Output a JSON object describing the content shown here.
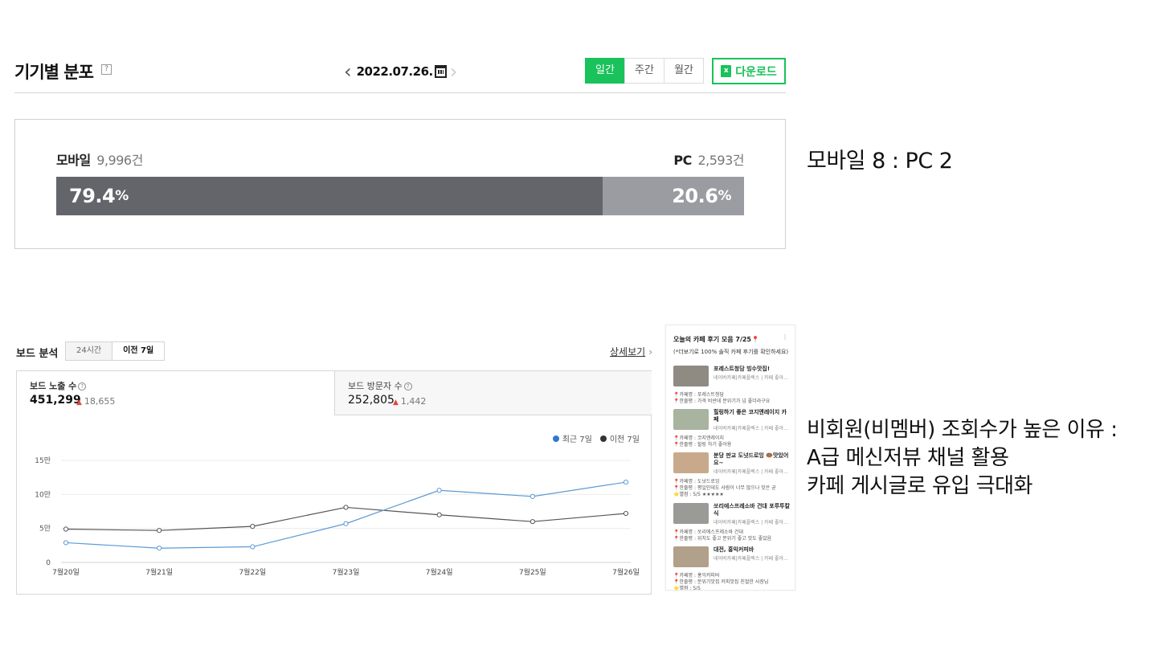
{
  "device": {
    "title": "기기별 분포",
    "help": "?",
    "date": "2022.07.26.",
    "periods": [
      "일간",
      "주간",
      "월간"
    ],
    "active_period": 0,
    "download_label": "다운로드",
    "download_icon_text": "x",
    "mobile_label": "모바일",
    "mobile_count": "9,996건",
    "pc_label": "PC",
    "pc_count": "2,593건",
    "mobile_pct": "79.4",
    "pc_pct": "20.6",
    "pct_unit": "%",
    "mobile_share": 0.794,
    "colors": {
      "accent": "#19c25a",
      "mobile": "#63656b",
      "pc": "#9b9ca1"
    }
  },
  "note1": "모바일 8 : PC 2",
  "board": {
    "title": "보드 분석",
    "tabs": [
      "24시간",
      "이전 7일"
    ],
    "active_tab": 1,
    "detail_link": "상세보기",
    "impressions_label": "보드 노출 수",
    "impressions_value": "451,299",
    "impressions_delta": "18,655",
    "visitors_label": "보드 방문자 수",
    "visitors_value": "252,805",
    "visitors_delta": "1,442",
    "legend_recent": "최근 7일",
    "legend_prev": "이전 7일"
  },
  "chart_data": {
    "type": "line",
    "x": [
      "7월20일",
      "7월21일",
      "7월22일",
      "7월23일",
      "7월24일",
      "7월25일",
      "7월26일"
    ],
    "y_ticks": [
      "0",
      "5만",
      "10만",
      "15만"
    ],
    "ylim": [
      0,
      150000
    ],
    "grid": true,
    "legend": "top-right",
    "series": [
      {
        "name": "최근 7일",
        "color": "#5b9bd5",
        "values": [
          29000,
          21000,
          23000,
          57000,
          106000,
          97000,
          118000
        ]
      },
      {
        "name": "이전 7일",
        "color": "#555555",
        "values": [
          49000,
          47000,
          53000,
          81000,
          70000,
          60000,
          72000
        ]
      }
    ]
  },
  "phone": {
    "title": "오늘의 카페 후기 모음 7/25📍",
    "subtitle": "(*더보기로 100% 솔직 카페 후기를 확인하세요)",
    "items": [
      {
        "name": "포레스트청담 빙수맛집!",
        "src": "네이버카페|카페플렉스 | 카페 좋아…",
        "meta": [
          "📍카페명 : 포레스트청담",
          "📍한줄평 : 가격 비싼데 분위기가 넘 좋더라구요"
        ]
      },
      {
        "name": "힐링하기 좋은 코지앤레이지 카페",
        "src": "네이버카페|카페플렉스 | 카페 좋아…",
        "meta": [
          "📍카페명 : 코지앤레이지",
          "📍한줄평 : 힐링 하기 좋아용"
        ]
      },
      {
        "name": "분당 판교 도넛드로잉 🍩맛있어요~",
        "src": "네이버카페|카페플렉스 | 카페 좋아…",
        "meta": [
          "📍카페명 : 도넛드로잉",
          "📍한줄평 : 평일인데도 사람이 너무 많으나 맛은 굳",
          "⭐별점 : 5/5 ★★★★★"
        ]
      },
      {
        "name": "쏘리에스프레소바 건대 포루투칼식",
        "src": "네이버카페|카페플렉스 | 카페 좋아…",
        "meta": [
          "📍카페명 : 쏘리에스프레소바 건대",
          "📍한줄평 : 위치도 좋고 분위기 좋고 맛도 좋았음"
        ]
      },
      {
        "name": "대전, 홍익커피바",
        "src": "네이버카페|카페플렉스 | 카페 좋아…",
        "meta": [
          "📍카페명 : 홍익커피바",
          "📍한줄평 : 분위기맛집 커피맛집 친절한 사장님",
          "⭐별점 : 5/5"
        ]
      }
    ]
  },
  "note2": [
    "비회원(비멤버) 조회수가 높은 이유 :",
    "A급 메신저뷰 채널 활용",
    "카페 게시글로 유입 극대화"
  ]
}
